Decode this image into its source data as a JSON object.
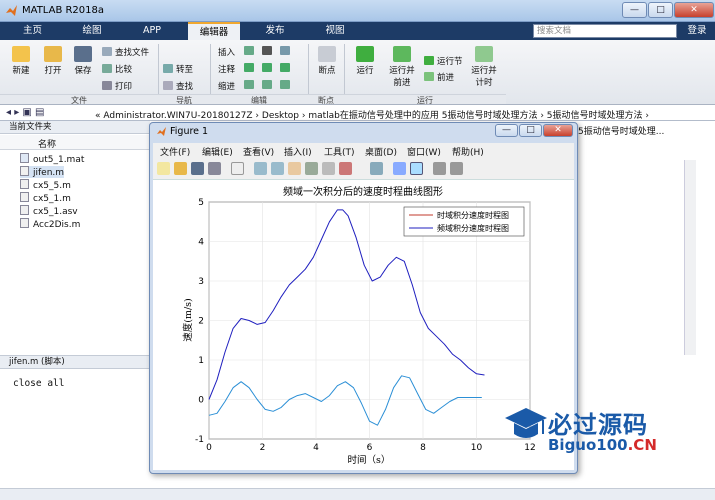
{
  "window": {
    "title": "MATLAB R2018a",
    "min": "—",
    "max": "□",
    "close": "✕"
  },
  "tabs": [
    "主页",
    "绘图",
    "APP",
    "编辑器",
    "发布",
    "视图"
  ],
  "active_tab": "编辑器",
  "search": {
    "placeholder": "搜索文档"
  },
  "signin": "登录",
  "ribbon": {
    "new": "新建",
    "open": "打开",
    "save": "保存",
    "find_files": "查找文件",
    "compare": "比较",
    "print": "打印",
    "goto": "转至",
    "find": "查找",
    "insert": "插入",
    "comment": "注释",
    "indent": "缩进",
    "breakpoints": "断点",
    "run": "运行",
    "run_advance": "运行并\n前进",
    "run_section": "运行节",
    "advance": "前进",
    "run_time": "运行并\n计时",
    "groups": [
      "文件",
      "导航",
      "编辑",
      "断点",
      "运行"
    ]
  },
  "address": "« Administrator.WIN7U-20180127Z  ›  Desktop  ›  matlab在振动信号处理中的应用 5振动信号时域处理方法  ›  5振动信号时域处理方法  ›",
  "current_folder": {
    "header": "当前文件夹",
    "name_col": "名称",
    "files": [
      "out5_1.mat",
      "jifen.m",
      "cx5_5.m",
      "cx5_1.m",
      "cx5_1.asv",
      "Acc2Dis.m"
    ],
    "selected": "jifen.m"
  },
  "details": {
    "header": "jifen.m  (脚本)"
  },
  "code": "close all",
  "right_panel_text": "5振动信号时域处理...",
  "figure": {
    "title": "Figure 1",
    "menu": [
      "文件(F)",
      "编辑(E)",
      "查看(V)",
      "插入(I)",
      "工具(T)",
      "桌面(D)",
      "窗口(W)",
      "帮助(H)"
    ]
  },
  "watermark": {
    "text": "必过源码",
    "url_main": "Biguo100",
    "url_tld": ".CN"
  },
  "chart_data": {
    "type": "line",
    "title": "频域一次积分后的速度时程曲线图形",
    "xlabel": "时间（s）",
    "ylabel": "速度(m/s)",
    "xlim": [
      0,
      12
    ],
    "ylim": [
      -1,
      5
    ],
    "xticks": [
      0,
      2,
      4,
      6,
      8,
      10,
      12
    ],
    "yticks": [
      -1,
      0,
      1,
      2,
      3,
      4,
      5
    ],
    "legend_position": "top-right",
    "colors": {
      "series1": "#c0392b",
      "series2": "#1f1fbf",
      "series3": "#2b8fd6"
    },
    "series": [
      {
        "name": "时域积分速度时程图",
        "x": [],
        "y": []
      },
      {
        "name": "频域积分速度时程图",
        "x": [
          0,
          0.3,
          0.6,
          0.9,
          1.2,
          1.5,
          1.8,
          2.1,
          2.4,
          2.7,
          3.0,
          3.3,
          3.6,
          3.9,
          4.2,
          4.5,
          4.8,
          5.0,
          5.2,
          5.5,
          5.8,
          6.1,
          6.4,
          6.7,
          7.0,
          7.3,
          7.6,
          7.9,
          8.2,
          8.5,
          8.8,
          9.1,
          9.4,
          9.7,
          10.0,
          10.3
        ],
        "y": [
          0,
          0.5,
          1.2,
          1.8,
          2.05,
          2.0,
          1.9,
          1.95,
          2.25,
          2.6,
          2.9,
          3.1,
          3.3,
          3.6,
          4.05,
          4.5,
          4.8,
          4.8,
          4.65,
          4.1,
          3.4,
          3.0,
          3.1,
          3.4,
          3.6,
          3.5,
          2.9,
          2.2,
          1.8,
          1.6,
          1.4,
          1.15,
          1.0,
          0.8,
          0.65,
          0.62
        ]
      },
      {
        "name": "",
        "x": [
          0,
          0.3,
          0.6,
          0.9,
          1.2,
          1.5,
          1.8,
          2.1,
          2.4,
          2.7,
          3.0,
          3.3,
          3.6,
          3.9,
          4.2,
          4.5,
          4.8,
          5.1,
          5.4,
          5.7,
          6.0,
          6.3,
          6.6,
          6.9,
          7.2,
          7.5,
          7.8,
          8.1,
          8.4,
          8.7,
          9.0,
          9.3,
          9.6,
          9.9,
          10.2
        ],
        "y": [
          -0.4,
          -0.35,
          -0.05,
          0.3,
          0.45,
          0.3,
          0.0,
          -0.25,
          -0.3,
          -0.2,
          0.0,
          0.1,
          0.15,
          0.05,
          -0.05,
          0.1,
          0.35,
          0.45,
          0.3,
          -0.1,
          -0.55,
          -0.65,
          -0.25,
          0.3,
          0.6,
          0.55,
          0.15,
          -0.25,
          -0.35,
          -0.2,
          -0.05,
          0.05,
          0.05,
          0.05,
          0.05
        ]
      }
    ]
  }
}
